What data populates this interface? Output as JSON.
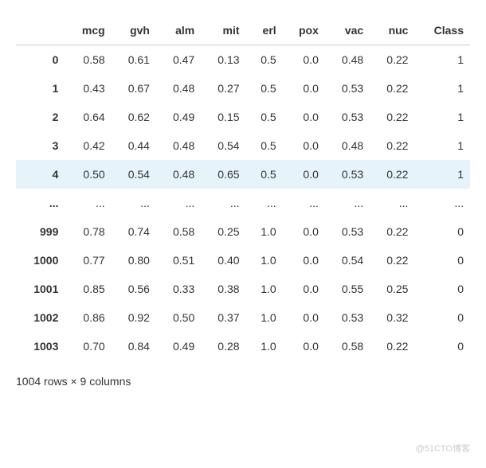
{
  "columns": [
    "",
    "mcg",
    "gvh",
    "alm",
    "mit",
    "erl",
    "pox",
    "vac",
    "nuc",
    "Class"
  ],
  "rows": [
    {
      "idx": "0",
      "vals": [
        "0.58",
        "0.61",
        "0.47",
        "0.13",
        "0.5",
        "0.0",
        "0.48",
        "0.22",
        "1"
      ],
      "hl": false
    },
    {
      "idx": "1",
      "vals": [
        "0.43",
        "0.67",
        "0.48",
        "0.27",
        "0.5",
        "0.0",
        "0.53",
        "0.22",
        "1"
      ],
      "hl": false
    },
    {
      "idx": "2",
      "vals": [
        "0.64",
        "0.62",
        "0.49",
        "0.15",
        "0.5",
        "0.0",
        "0.53",
        "0.22",
        "1"
      ],
      "hl": false
    },
    {
      "idx": "3",
      "vals": [
        "0.42",
        "0.44",
        "0.48",
        "0.54",
        "0.5",
        "0.0",
        "0.48",
        "0.22",
        "1"
      ],
      "hl": false
    },
    {
      "idx": "4",
      "vals": [
        "0.50",
        "0.54",
        "0.48",
        "0.65",
        "0.5",
        "0.0",
        "0.53",
        "0.22",
        "1"
      ],
      "hl": true
    },
    {
      "idx": "...",
      "vals": [
        "...",
        "...",
        "...",
        "...",
        "...",
        "...",
        "...",
        "...",
        "..."
      ],
      "hl": false,
      "ellipsis": true
    },
    {
      "idx": "999",
      "vals": [
        "0.78",
        "0.74",
        "0.58",
        "0.25",
        "1.0",
        "0.0",
        "0.53",
        "0.22",
        "0"
      ],
      "hl": false
    },
    {
      "idx": "1000",
      "vals": [
        "0.77",
        "0.80",
        "0.51",
        "0.40",
        "1.0",
        "0.0",
        "0.54",
        "0.22",
        "0"
      ],
      "hl": false
    },
    {
      "idx": "1001",
      "vals": [
        "0.85",
        "0.56",
        "0.33",
        "0.38",
        "1.0",
        "0.0",
        "0.55",
        "0.25",
        "0"
      ],
      "hl": false
    },
    {
      "idx": "1002",
      "vals": [
        "0.86",
        "0.92",
        "0.50",
        "0.37",
        "1.0",
        "0.0",
        "0.53",
        "0.32",
        "0"
      ],
      "hl": false
    },
    {
      "idx": "1003",
      "vals": [
        "0.70",
        "0.84",
        "0.49",
        "0.28",
        "1.0",
        "0.0",
        "0.58",
        "0.22",
        "0"
      ],
      "hl": false
    }
  ],
  "footer": "1004 rows × 9 columns",
  "watermark": "@51CTO博客",
  "chart_data": {
    "type": "table",
    "columns": [
      "mcg",
      "gvh",
      "alm",
      "mit",
      "erl",
      "pox",
      "vac",
      "nuc",
      "Class"
    ],
    "index": [
      "0",
      "1",
      "2",
      "3",
      "4",
      "...",
      "999",
      "1000",
      "1001",
      "1002",
      "1003"
    ],
    "data": [
      [
        0.58,
        0.61,
        0.47,
        0.13,
        0.5,
        0.0,
        0.48,
        0.22,
        1
      ],
      [
        0.43,
        0.67,
        0.48,
        0.27,
        0.5,
        0.0,
        0.53,
        0.22,
        1
      ],
      [
        0.64,
        0.62,
        0.49,
        0.15,
        0.5,
        0.0,
        0.53,
        0.22,
        1
      ],
      [
        0.42,
        0.44,
        0.48,
        0.54,
        0.5,
        0.0,
        0.48,
        0.22,
        1
      ],
      [
        0.5,
        0.54,
        0.48,
        0.65,
        0.5,
        0.0,
        0.53,
        0.22,
        1
      ],
      null,
      [
        0.78,
        0.74,
        0.58,
        0.25,
        1.0,
        0.0,
        0.53,
        0.22,
        0
      ],
      [
        0.77,
        0.8,
        0.51,
        0.4,
        1.0,
        0.0,
        0.54,
        0.22,
        0
      ],
      [
        0.85,
        0.56,
        0.33,
        0.38,
        1.0,
        0.0,
        0.55,
        0.25,
        0
      ],
      [
        0.86,
        0.92,
        0.5,
        0.37,
        1.0,
        0.0,
        0.53,
        0.32,
        0
      ],
      [
        0.7,
        0.84,
        0.49,
        0.28,
        1.0,
        0.0,
        0.58,
        0.22,
        0
      ]
    ],
    "shape": [
      1004,
      9
    ]
  }
}
